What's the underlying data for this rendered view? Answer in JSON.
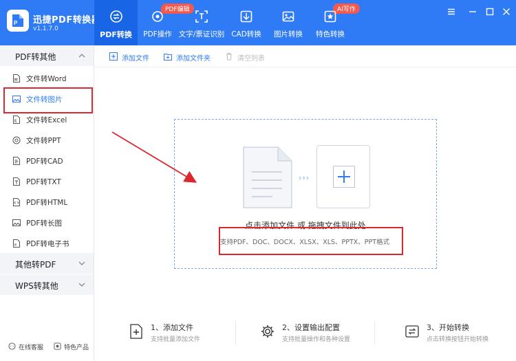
{
  "app": {
    "name": "迅捷PDF转换器",
    "version": "v1.1.7.0"
  },
  "tabs": [
    {
      "label": "PDF转换",
      "icon": "convert-icon",
      "active": true
    },
    {
      "label": "PDF操作",
      "icon": "pdf-ops-icon",
      "badge": "PDF编辑"
    },
    {
      "label": "文字/票证识别",
      "icon": "ocr-icon"
    },
    {
      "label": "CAD转换",
      "icon": "cad-icon"
    },
    {
      "label": "图片转换",
      "icon": "image-icon"
    },
    {
      "label": "特色转换",
      "icon": "special-icon",
      "badge": "AI写作"
    }
  ],
  "sidebar": {
    "section1": "PDF转其他",
    "items": [
      {
        "label": "文件转Word",
        "icon": "word-icon"
      },
      {
        "label": "文件转图片",
        "icon": "picture-icon",
        "active": true
      },
      {
        "label": "文件转Excel",
        "icon": "excel-icon"
      },
      {
        "label": "文件转PPT",
        "icon": "ppt-icon"
      },
      {
        "label": "PDF转CAD",
        "icon": "cad-file-icon"
      },
      {
        "label": "PDF转TXT",
        "icon": "txt-icon"
      },
      {
        "label": "PDF转HTML",
        "icon": "html-icon"
      },
      {
        "label": "PDF转长图",
        "icon": "long-image-icon"
      },
      {
        "label": "PDF转电子书",
        "icon": "ebook-icon"
      }
    ],
    "section2": "其他转PDF",
    "section3": "WPS转其他",
    "footer": {
      "service": "在线客服",
      "products": "特色产品"
    }
  },
  "toolbar": {
    "add_file": "添加文件",
    "add_folder": "添加文件夹",
    "clear_list": "清空列表"
  },
  "dropzone": {
    "arrows": "›››",
    "title": "点击添加文件 或 拖拽文件到此处",
    "formats": "支持PDF、DOC、DOCX、XLSX、XLS、PPTX、PPT格式"
  },
  "steps": [
    {
      "title": "1、添加文件",
      "desc": "支持批量添加文件"
    },
    {
      "title": "2、设置输出配置",
      "desc": "支持批量操作和各种设置"
    },
    {
      "title": "3、开始转换",
      "desc": "点击转换按钮开始转换"
    }
  ],
  "colors": {
    "primary": "#2f7bf5",
    "active_tab": "#1865e6",
    "badge": "#f25a4f",
    "annotation": "#d9292e"
  }
}
